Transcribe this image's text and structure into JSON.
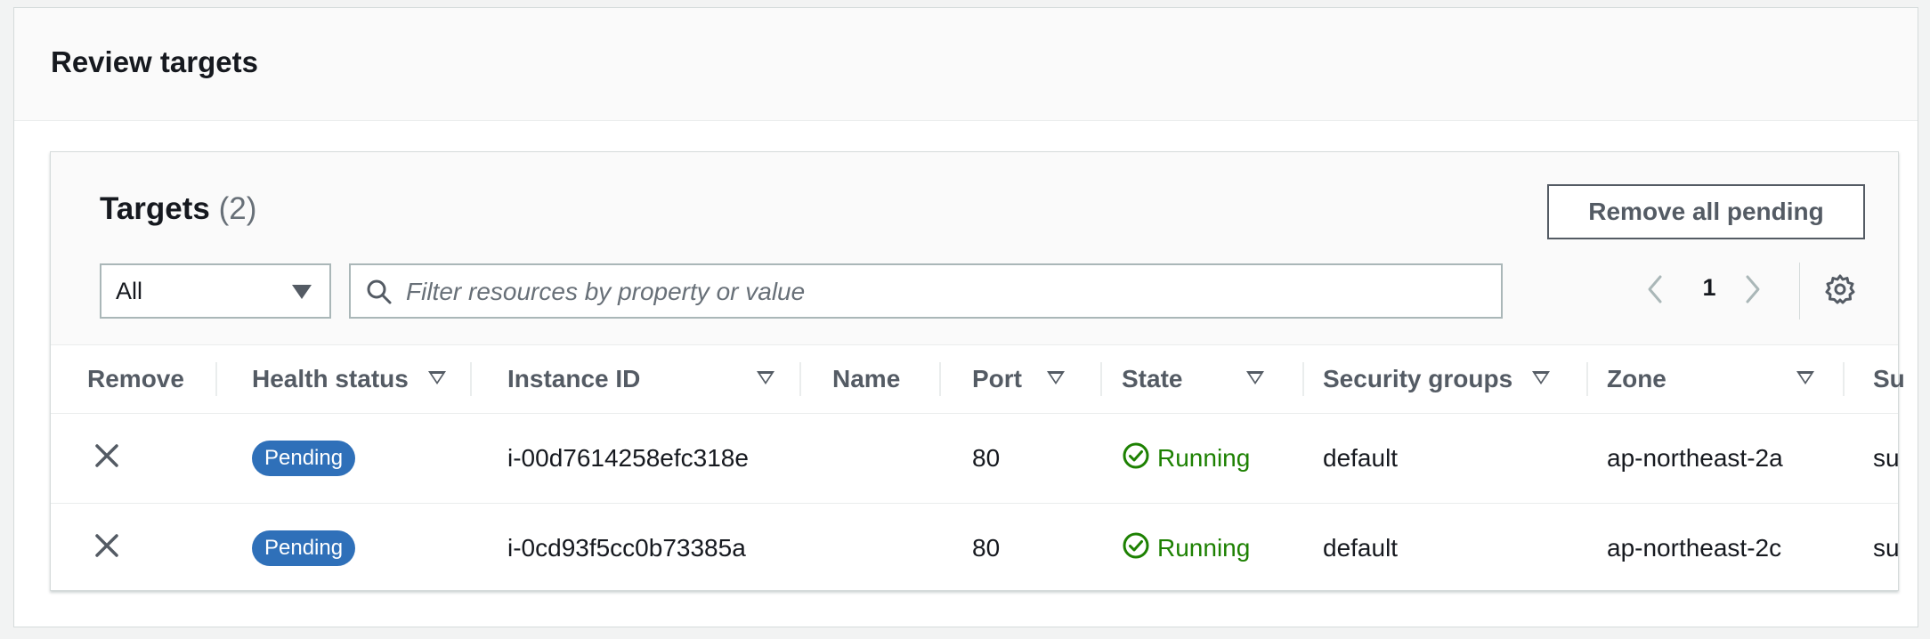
{
  "panel": {
    "title": "Review targets"
  },
  "targets": {
    "title": "Targets",
    "count": "(2)",
    "remove_all_label": "Remove all pending",
    "filter_select": {
      "selected": "All"
    },
    "search": {
      "placeholder": "Filter resources by property or value",
      "value": ""
    },
    "pagination": {
      "current_page": "1"
    }
  },
  "table": {
    "columns": {
      "remove": "Remove",
      "health": "Health status",
      "instance": "Instance ID",
      "name": "Name",
      "port": "Port",
      "state": "State",
      "sg": "Security groups",
      "zone": "Zone",
      "subnet": "Su"
    },
    "rows": [
      {
        "health": "Pending",
        "instance_id": "i-00d7614258efc318e",
        "name": "",
        "port": "80",
        "state": "Running",
        "security_groups": "default",
        "zone": "ap-northeast-2a",
        "subnet": "su"
      },
      {
        "health": "Pending",
        "instance_id": "i-0cd93f5cc0b73385a",
        "name": "",
        "port": "80",
        "state": "Running",
        "security_groups": "default",
        "zone": "ap-northeast-2c",
        "subnet": "su"
      }
    ]
  },
  "colors": {
    "pending_badge": "#2f70b9",
    "running_text": "#1d8102",
    "border": "#d5dbdb"
  },
  "icons": {
    "search": "search-icon",
    "prev": "chevron-left-icon",
    "next": "chevron-right-icon",
    "settings": "gear-icon",
    "remove": "close-icon",
    "running": "check-circle-icon",
    "sort": "sort-caret-icon",
    "select": "caret-down-icon"
  }
}
